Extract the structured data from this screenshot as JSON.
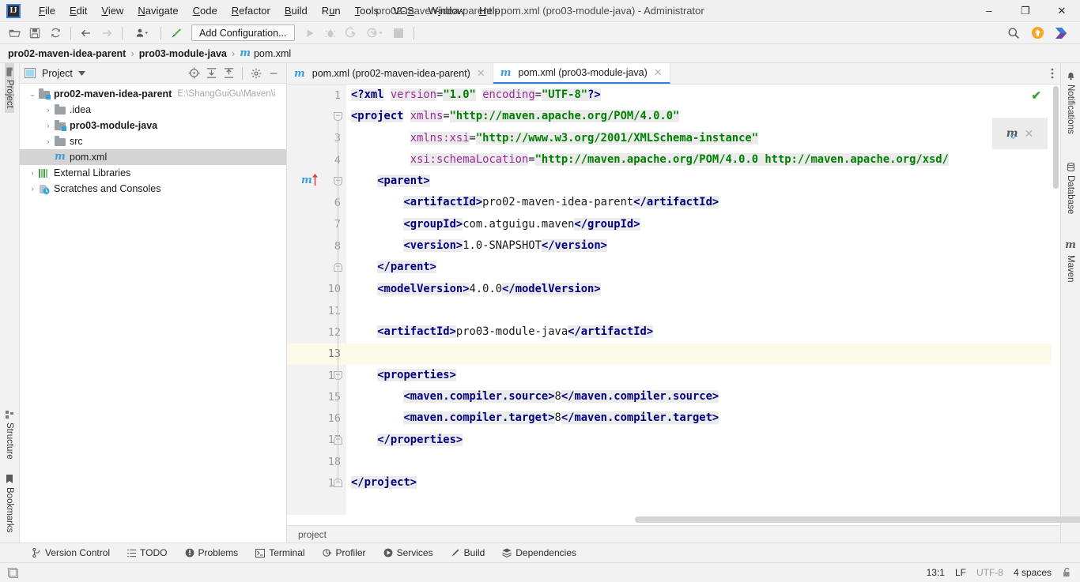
{
  "window": {
    "title": "pro02-maven-idea-parent - pom.xml (pro03-module-java) - Administrator",
    "minimize": "–",
    "maximize": "❐",
    "close": "✕",
    "logo_text": "IJ"
  },
  "menubar": {
    "items": [
      {
        "label": "File"
      },
      {
        "label": "Edit"
      },
      {
        "label": "View"
      },
      {
        "label": "Navigate"
      },
      {
        "label": "Code"
      },
      {
        "label": "Refactor"
      },
      {
        "label": "Build"
      },
      {
        "label": "Run"
      },
      {
        "label": "Tools"
      },
      {
        "label": "VCS"
      },
      {
        "label": "Window"
      },
      {
        "label": "Help"
      }
    ]
  },
  "toolbar": {
    "open_icon": "open-folder-icon",
    "save_icon": "save-icon",
    "sync_icon": "sync-icon",
    "back_icon": "back-arrow-icon",
    "forward_icon": "forward-arrow-icon",
    "profile_icon": "user-profile-icon",
    "build_icon": "build-hammer-icon",
    "add_configuration": "Add Configuration...",
    "run_icon": "run-icon",
    "debug_icon": "debug-icon",
    "coverage_icon": "run-with-coverage-icon",
    "profiler_icon": "profiler-icon",
    "stop_icon": "stop-icon",
    "search_icon": "search-icon",
    "update_icon": "update-available-icon",
    "ide_icon": "ide-features-icon"
  },
  "breadcrumb": {
    "items": [
      {
        "label": "pro02-maven-idea-parent",
        "bold": true
      },
      {
        "label": "pro03-module-java",
        "bold": true
      },
      {
        "label": "pom.xml",
        "bold": false,
        "icon": "maven-file-icon"
      }
    ],
    "separator": "›"
  },
  "left_strip": {
    "project_tab": "Project",
    "structure_tab": "Structure",
    "bookmarks_tab": "Bookmarks"
  },
  "right_strip": {
    "notifications_tab": "Notifications",
    "database_tab": "Database",
    "maven_tab": "Maven"
  },
  "project_panel": {
    "title": "Project",
    "dropdown_icon": "chevron-down-icon",
    "locate_icon": "locate-icon",
    "expand_icon": "expand-all-icon",
    "collapse_icon": "collapse-all-icon",
    "settings_icon": "gear-icon",
    "hide_icon": "hide-icon",
    "tree": [
      {
        "label": "pro02-maven-idea-parent",
        "path": "E:\\ShangGuiGu\\Maven\\i",
        "indent": 0,
        "arrow": "expanded",
        "icon": "module-folder-icon",
        "bold": true,
        "selected": false
      },
      {
        "label": ".idea",
        "path": "",
        "indent": 1,
        "arrow": "collapsed",
        "icon": "folder-icon",
        "bold": false,
        "selected": false
      },
      {
        "label": "pro03-module-java",
        "path": "",
        "indent": 1,
        "arrow": "collapsed",
        "icon": "module-folder-icon",
        "bold": true,
        "selected": false
      },
      {
        "label": "src",
        "path": "",
        "indent": 1,
        "arrow": "collapsed",
        "icon": "folder-icon",
        "bold": false,
        "selected": false
      },
      {
        "label": "pom.xml",
        "path": "",
        "indent": 1,
        "arrow": "none",
        "icon": "maven-file-icon",
        "bold": false,
        "selected": true
      },
      {
        "label": "External Libraries",
        "path": "",
        "indent": 0,
        "arrow": "collapsed",
        "icon": "libraries-icon",
        "bold": false,
        "selected": false
      },
      {
        "label": "Scratches and Consoles",
        "path": "",
        "indent": 0,
        "arrow": "collapsed",
        "icon": "scratches-icon",
        "bold": false,
        "selected": false
      }
    ]
  },
  "editor": {
    "tabs": [
      {
        "label": "pom.xml (pro02-maven-idea-parent)",
        "icon": "maven-file-icon",
        "active": false,
        "close": "✕"
      },
      {
        "label": "pom.xml (pro03-module-java)",
        "icon": "maven-file-icon",
        "active": true,
        "close": "✕"
      }
    ],
    "more_icon": "more-vertical-icon",
    "inspection_status": "✔",
    "maven_popup": {
      "icon": "maven-reload-icon",
      "close": "✕"
    },
    "breadcrumb_bottom": "project",
    "current_line": 13,
    "gutter_markers": {
      "line5": "maven-parent-navigate-icon",
      "line12": "intention-bulb-icon"
    },
    "line_numbers": [
      1,
      2,
      3,
      4,
      5,
      6,
      7,
      8,
      9,
      10,
      11,
      12,
      13,
      14,
      15,
      16,
      17,
      18,
      19
    ],
    "code_lines": [
      {
        "n": 1,
        "tokens": [
          {
            "t": "<?",
            "c": "pi"
          },
          {
            "t": "xml",
            "c": "tag"
          },
          {
            "t": " ",
            "c": "txt"
          },
          {
            "t": "version",
            "c": "att"
          },
          {
            "t": "=",
            "c": "txt"
          },
          {
            "t": "\"1.0\"",
            "c": "val"
          },
          {
            "t": " ",
            "c": "txt"
          },
          {
            "t": "encoding",
            "c": "att"
          },
          {
            "t": "=",
            "c": "txt"
          },
          {
            "t": "\"UTF-8\"",
            "c": "val"
          },
          {
            "t": "?>",
            "c": "pi"
          }
        ]
      },
      {
        "n": 2,
        "tokens": [
          {
            "t": "<project",
            "c": "tag"
          },
          {
            "t": " ",
            "c": "txt"
          },
          {
            "t": "xmlns",
            "c": "att"
          },
          {
            "t": "=",
            "c": "txt"
          },
          {
            "t": "\"http://maven.apache.org/POM/4.0.0\"",
            "c": "val"
          }
        ]
      },
      {
        "n": 3,
        "tokens": [
          {
            "t": "         ",
            "c": "txt"
          },
          {
            "t": "xmlns:xsi",
            "c": "att"
          },
          {
            "t": "=",
            "c": "txt"
          },
          {
            "t": "\"http://www.w3.org/2001/XMLSchema-instance\"",
            "c": "val"
          }
        ]
      },
      {
        "n": 4,
        "tokens": [
          {
            "t": "         ",
            "c": "txt"
          },
          {
            "t": "xsi:schemaLocation",
            "c": "att"
          },
          {
            "t": "=",
            "c": "txt"
          },
          {
            "t": "\"http://maven.apache.org/POM/4.0.0 http://maven.apache.org/xsd/",
            "c": "val"
          }
        ]
      },
      {
        "n": 5,
        "tokens": [
          {
            "t": "    ",
            "c": "txt"
          },
          {
            "t": "<parent>",
            "c": "tag"
          }
        ]
      },
      {
        "n": 6,
        "tokens": [
          {
            "t": "        ",
            "c": "txt"
          },
          {
            "t": "<artifactId>",
            "c": "tag"
          },
          {
            "t": "pro02-maven-idea-parent",
            "c": "txt"
          },
          {
            "t": "</artifactId>",
            "c": "tag"
          }
        ]
      },
      {
        "n": 7,
        "tokens": [
          {
            "t": "        ",
            "c": "txt"
          },
          {
            "t": "<groupId>",
            "c": "tag"
          },
          {
            "t": "com.atguigu.maven",
            "c": "txt"
          },
          {
            "t": "</groupId>",
            "c": "tag"
          }
        ]
      },
      {
        "n": 8,
        "tokens": [
          {
            "t": "        ",
            "c": "txt"
          },
          {
            "t": "<version>",
            "c": "tag"
          },
          {
            "t": "1.0-SNAPSHOT",
            "c": "txt"
          },
          {
            "t": "</version>",
            "c": "tag"
          }
        ]
      },
      {
        "n": 9,
        "tokens": [
          {
            "t": "    ",
            "c": "txt"
          },
          {
            "t": "</parent>",
            "c": "tag"
          }
        ]
      },
      {
        "n": 10,
        "tokens": [
          {
            "t": "    ",
            "c": "txt"
          },
          {
            "t": "<modelVersion>",
            "c": "tag"
          },
          {
            "t": "4.0.0",
            "c": "txt"
          },
          {
            "t": "</modelVersion>",
            "c": "tag"
          }
        ]
      },
      {
        "n": 11,
        "tokens": []
      },
      {
        "n": 12,
        "tokens": [
          {
            "t": "    ",
            "c": "txt"
          },
          {
            "t": "<artifactId>",
            "c": "tag"
          },
          {
            "t": "pro03-module-java",
            "c": "txt"
          },
          {
            "t": "</artifactId>",
            "c": "tag"
          }
        ]
      },
      {
        "n": 13,
        "tokens": []
      },
      {
        "n": 14,
        "tokens": [
          {
            "t": "    ",
            "c": "txt"
          },
          {
            "t": "<properties>",
            "c": "tag"
          }
        ]
      },
      {
        "n": 15,
        "tokens": [
          {
            "t": "        ",
            "c": "txt"
          },
          {
            "t": "<maven.compiler.source>",
            "c": "tag"
          },
          {
            "t": "8",
            "c": "txt"
          },
          {
            "t": "</maven.compiler.source>",
            "c": "tag"
          }
        ]
      },
      {
        "n": 16,
        "tokens": [
          {
            "t": "        ",
            "c": "txt"
          },
          {
            "t": "<maven.compiler.target>",
            "c": "tag"
          },
          {
            "t": "8",
            "c": "txt"
          },
          {
            "t": "</maven.compiler.target>",
            "c": "tag"
          }
        ]
      },
      {
        "n": 17,
        "tokens": [
          {
            "t": "    ",
            "c": "txt"
          },
          {
            "t": "</properties>",
            "c": "tag"
          }
        ]
      },
      {
        "n": 18,
        "tokens": []
      },
      {
        "n": 19,
        "tokens": [
          {
            "t": "</project>",
            "c": "tag"
          }
        ]
      }
    ]
  },
  "bottom_tools": [
    {
      "label": "Version Control",
      "icon": "branch-icon"
    },
    {
      "label": "TODO",
      "icon": "list-icon"
    },
    {
      "label": "Problems",
      "icon": "problems-icon"
    },
    {
      "label": "Terminal",
      "icon": "terminal-icon"
    },
    {
      "label": "Profiler",
      "icon": "profiler-icon"
    },
    {
      "label": "Services",
      "icon": "services-icon"
    },
    {
      "label": "Build",
      "icon": "build-hammer-icon"
    },
    {
      "label": "Dependencies",
      "icon": "dependencies-icon"
    }
  ],
  "statusbar": {
    "left_icon": "layout-icon",
    "caret_position": "13:1",
    "line_separator": "LF",
    "encoding": "UTF-8",
    "indent": "4 spaces",
    "lock_icon": "unlocked-icon"
  },
  "colors": {
    "accent": "#3b7dd8",
    "tag": "#000080",
    "attribute": "#9e2a9e",
    "value": "#008000",
    "current_line": "#fcf9e8",
    "maven_blue": "#3b9fd6"
  }
}
